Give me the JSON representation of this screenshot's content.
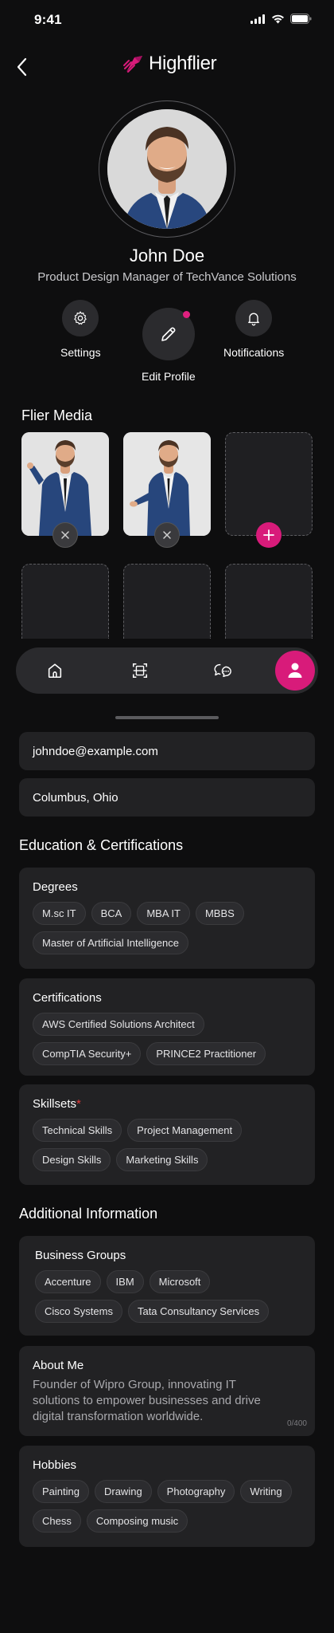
{
  "status_bar": {
    "time": "9:41"
  },
  "header": {
    "app_name": "Highflier",
    "brand_color": "#d81b7a"
  },
  "profile": {
    "name": "John Doe",
    "role": "Product Design Manager of TechVance Solutions"
  },
  "actions": {
    "settings": "Settings",
    "edit_profile": "Edit Profile",
    "notifications": "Notifications"
  },
  "flier_media": {
    "title": "Flier Media",
    "tiles": [
      {
        "type": "photo",
        "icon": "remove-icon"
      },
      {
        "type": "photo",
        "icon": "remove-icon"
      },
      {
        "type": "empty",
        "icon": "add-icon"
      },
      {
        "type": "empty"
      },
      {
        "type": "empty"
      },
      {
        "type": "empty"
      }
    ]
  },
  "tabbar": {
    "items": [
      "home-icon",
      "scan-icon",
      "chat-icon",
      "profile-icon"
    ],
    "active": "profile-icon"
  },
  "contact": {
    "email": "johndoe@example.com",
    "location": "Columbus, Ohio"
  },
  "education": {
    "title": "Education & Certifications",
    "degrees": {
      "label": "Degrees",
      "items": [
        "M.sc IT",
        "BCA",
        "MBA IT",
        "MBBS",
        "Master of Artificial Intelligence"
      ]
    },
    "certifications": {
      "label": "Certifications",
      "items": [
        "AWS Certified Solutions Architect",
        "CompTIA Security+",
        "PRINCE2 Practitioner"
      ]
    },
    "skillsets": {
      "label": "Skillsets",
      "required_mark": "*",
      "items": [
        "Technical Skills",
        "Project Management",
        "Design Skills",
        "Marketing Skills"
      ]
    }
  },
  "additional": {
    "title": "Additional Information",
    "business_groups": {
      "label": "Business Groups",
      "items": [
        "Accenture",
        "IBM",
        "Microsoft",
        "Cisco Systems",
        "Tata Consultancy Services"
      ]
    },
    "about": {
      "label": "About Me",
      "text": "Founder of Wipro Group, innovating IT solutions to empower businesses and drive digital transformation worldwide.",
      "counter": "0/400"
    },
    "hobbies": {
      "label": "Hobbies",
      "items": [
        "Painting",
        "Drawing",
        "Photography",
        "Writing",
        "Chess",
        "Composing music"
      ]
    }
  }
}
